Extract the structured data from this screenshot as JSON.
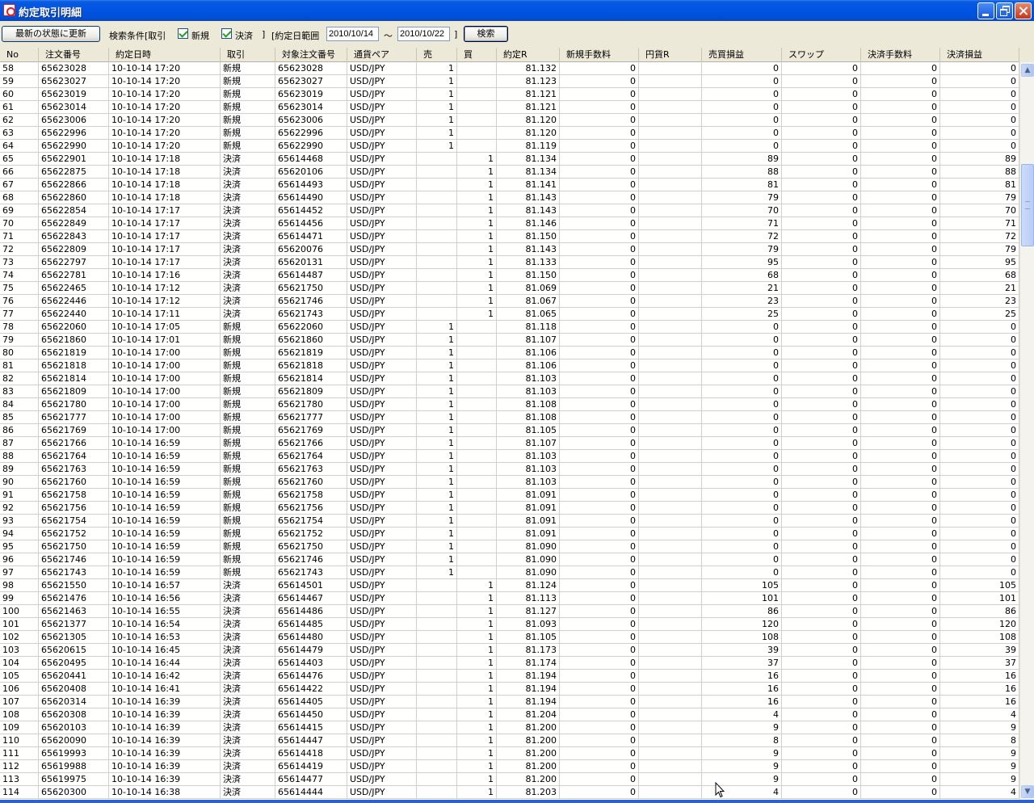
{
  "window": {
    "title": "約定取引明細",
    "icons": {
      "app": "app-logo-icon",
      "minimize": "minimize-icon",
      "maximize": "restore-icon",
      "close": "close-icon"
    }
  },
  "toolbar": {
    "refresh_label": "最新の状態に更新",
    "search_conditions_label": "検索条件[取引",
    "new_label": "新規",
    "settle_label": "決済",
    "bracket_close": "]",
    "date_range_label": "[約定日範囲",
    "date_from": "2010/10/14",
    "tilde": "〜",
    "date_to": "2010/10/22",
    "bracket_close2": "]",
    "search_label": "検索",
    "new_checked": true,
    "settle_checked": true
  },
  "grid": {
    "columns": [
      "No",
      "注文番号",
      "約定日時",
      "取引",
      "対象注文番号",
      "通貨ペア",
      "売",
      "買",
      "約定R",
      "新規手数料",
      "円貨R",
      "売買損益",
      "スワップ",
      "決済手数料",
      "決済損益"
    ],
    "rows": [
      [
        "58",
        "65623028",
        "10-10-14 17:20",
        "新規",
        "65623028",
        "USD/JPY",
        "1",
        "",
        "81.132",
        "0",
        "",
        "0",
        "0",
        "0",
        "0"
      ],
      [
        "59",
        "65623027",
        "10-10-14 17:20",
        "新規",
        "65623027",
        "USD/JPY",
        "1",
        "",
        "81.123",
        "0",
        "",
        "0",
        "0",
        "0",
        "0"
      ],
      [
        "60",
        "65623019",
        "10-10-14 17:20",
        "新規",
        "65623019",
        "USD/JPY",
        "1",
        "",
        "81.121",
        "0",
        "",
        "0",
        "0",
        "0",
        "0"
      ],
      [
        "61",
        "65623014",
        "10-10-14 17:20",
        "新規",
        "65623014",
        "USD/JPY",
        "1",
        "",
        "81.121",
        "0",
        "",
        "0",
        "0",
        "0",
        "0"
      ],
      [
        "62",
        "65623006",
        "10-10-14 17:20",
        "新規",
        "65623006",
        "USD/JPY",
        "1",
        "",
        "81.120",
        "0",
        "",
        "0",
        "0",
        "0",
        "0"
      ],
      [
        "63",
        "65622996",
        "10-10-14 17:20",
        "新規",
        "65622996",
        "USD/JPY",
        "1",
        "",
        "81.120",
        "0",
        "",
        "0",
        "0",
        "0",
        "0"
      ],
      [
        "64",
        "65622990",
        "10-10-14 17:20",
        "新規",
        "65622990",
        "USD/JPY",
        "1",
        "",
        "81.119",
        "0",
        "",
        "0",
        "0",
        "0",
        "0"
      ],
      [
        "65",
        "65622901",
        "10-10-14 17:18",
        "決済",
        "65614468",
        "USD/JPY",
        "",
        "1",
        "81.134",
        "0",
        "",
        "89",
        "0",
        "0",
        "89"
      ],
      [
        "66",
        "65622875",
        "10-10-14 17:18",
        "決済",
        "65620106",
        "USD/JPY",
        "",
        "1",
        "81.134",
        "0",
        "",
        "88",
        "0",
        "0",
        "88"
      ],
      [
        "67",
        "65622866",
        "10-10-14 17:18",
        "決済",
        "65614493",
        "USD/JPY",
        "",
        "1",
        "81.141",
        "0",
        "",
        "81",
        "0",
        "0",
        "81"
      ],
      [
        "68",
        "65622860",
        "10-10-14 17:18",
        "決済",
        "65614490",
        "USD/JPY",
        "",
        "1",
        "81.143",
        "0",
        "",
        "79",
        "0",
        "0",
        "79"
      ],
      [
        "69",
        "65622854",
        "10-10-14 17:17",
        "決済",
        "65614452",
        "USD/JPY",
        "",
        "1",
        "81.143",
        "0",
        "",
        "70",
        "0",
        "0",
        "70"
      ],
      [
        "70",
        "65622849",
        "10-10-14 17:17",
        "決済",
        "65614456",
        "USD/JPY",
        "",
        "1",
        "81.146",
        "0",
        "",
        "71",
        "0",
        "0",
        "71"
      ],
      [
        "71",
        "65622843",
        "10-10-14 17:17",
        "決済",
        "65614471",
        "USD/JPY",
        "",
        "1",
        "81.150",
        "0",
        "",
        "72",
        "0",
        "0",
        "72"
      ],
      [
        "72",
        "65622809",
        "10-10-14 17:17",
        "決済",
        "65620076",
        "USD/JPY",
        "",
        "1",
        "81.143",
        "0",
        "",
        "79",
        "0",
        "0",
        "79"
      ],
      [
        "73",
        "65622797",
        "10-10-14 17:17",
        "決済",
        "65620131",
        "USD/JPY",
        "",
        "1",
        "81.133",
        "0",
        "",
        "95",
        "0",
        "0",
        "95"
      ],
      [
        "74",
        "65622781",
        "10-10-14 17:16",
        "決済",
        "65614487",
        "USD/JPY",
        "",
        "1",
        "81.150",
        "0",
        "",
        "68",
        "0",
        "0",
        "68"
      ],
      [
        "75",
        "65622465",
        "10-10-14 17:12",
        "決済",
        "65621750",
        "USD/JPY",
        "",
        "1",
        "81.069",
        "0",
        "",
        "21",
        "0",
        "0",
        "21"
      ],
      [
        "76",
        "65622446",
        "10-10-14 17:12",
        "決済",
        "65621746",
        "USD/JPY",
        "",
        "1",
        "81.067",
        "0",
        "",
        "23",
        "0",
        "0",
        "23"
      ],
      [
        "77",
        "65622440",
        "10-10-14 17:11",
        "決済",
        "65621743",
        "USD/JPY",
        "",
        "1",
        "81.065",
        "0",
        "",
        "25",
        "0",
        "0",
        "25"
      ],
      [
        "78",
        "65622060",
        "10-10-14 17:05",
        "新規",
        "65622060",
        "USD/JPY",
        "1",
        "",
        "81.118",
        "0",
        "",
        "0",
        "0",
        "0",
        "0"
      ],
      [
        "79",
        "65621860",
        "10-10-14 17:01",
        "新規",
        "65621860",
        "USD/JPY",
        "1",
        "",
        "81.107",
        "0",
        "",
        "0",
        "0",
        "0",
        "0"
      ],
      [
        "80",
        "65621819",
        "10-10-14 17:00",
        "新規",
        "65621819",
        "USD/JPY",
        "1",
        "",
        "81.106",
        "0",
        "",
        "0",
        "0",
        "0",
        "0"
      ],
      [
        "81",
        "65621818",
        "10-10-14 17:00",
        "新規",
        "65621818",
        "USD/JPY",
        "1",
        "",
        "81.106",
        "0",
        "",
        "0",
        "0",
        "0",
        "0"
      ],
      [
        "82",
        "65621814",
        "10-10-14 17:00",
        "新規",
        "65621814",
        "USD/JPY",
        "1",
        "",
        "81.103",
        "0",
        "",
        "0",
        "0",
        "0",
        "0"
      ],
      [
        "83",
        "65621809",
        "10-10-14 17:00",
        "新規",
        "65621809",
        "USD/JPY",
        "1",
        "",
        "81.103",
        "0",
        "",
        "0",
        "0",
        "0",
        "0"
      ],
      [
        "84",
        "65621780",
        "10-10-14 17:00",
        "新規",
        "65621780",
        "USD/JPY",
        "1",
        "",
        "81.108",
        "0",
        "",
        "0",
        "0",
        "0",
        "0"
      ],
      [
        "85",
        "65621777",
        "10-10-14 17:00",
        "新規",
        "65621777",
        "USD/JPY",
        "1",
        "",
        "81.108",
        "0",
        "",
        "0",
        "0",
        "0",
        "0"
      ],
      [
        "86",
        "65621769",
        "10-10-14 17:00",
        "新規",
        "65621769",
        "USD/JPY",
        "1",
        "",
        "81.105",
        "0",
        "",
        "0",
        "0",
        "0",
        "0"
      ],
      [
        "87",
        "65621766",
        "10-10-14 16:59",
        "新規",
        "65621766",
        "USD/JPY",
        "1",
        "",
        "81.107",
        "0",
        "",
        "0",
        "0",
        "0",
        "0"
      ],
      [
        "88",
        "65621764",
        "10-10-14 16:59",
        "新規",
        "65621764",
        "USD/JPY",
        "1",
        "",
        "81.103",
        "0",
        "",
        "0",
        "0",
        "0",
        "0"
      ],
      [
        "89",
        "65621763",
        "10-10-14 16:59",
        "新規",
        "65621763",
        "USD/JPY",
        "1",
        "",
        "81.103",
        "0",
        "",
        "0",
        "0",
        "0",
        "0"
      ],
      [
        "90",
        "65621760",
        "10-10-14 16:59",
        "新規",
        "65621760",
        "USD/JPY",
        "1",
        "",
        "81.103",
        "0",
        "",
        "0",
        "0",
        "0",
        "0"
      ],
      [
        "91",
        "65621758",
        "10-10-14 16:59",
        "新規",
        "65621758",
        "USD/JPY",
        "1",
        "",
        "81.091",
        "0",
        "",
        "0",
        "0",
        "0",
        "0"
      ],
      [
        "92",
        "65621756",
        "10-10-14 16:59",
        "新規",
        "65621756",
        "USD/JPY",
        "1",
        "",
        "81.091",
        "0",
        "",
        "0",
        "0",
        "0",
        "0"
      ],
      [
        "93",
        "65621754",
        "10-10-14 16:59",
        "新規",
        "65621754",
        "USD/JPY",
        "1",
        "",
        "81.091",
        "0",
        "",
        "0",
        "0",
        "0",
        "0"
      ],
      [
        "94",
        "65621752",
        "10-10-14 16:59",
        "新規",
        "65621752",
        "USD/JPY",
        "1",
        "",
        "81.091",
        "0",
        "",
        "0",
        "0",
        "0",
        "0"
      ],
      [
        "95",
        "65621750",
        "10-10-14 16:59",
        "新規",
        "65621750",
        "USD/JPY",
        "1",
        "",
        "81.090",
        "0",
        "",
        "0",
        "0",
        "0",
        "0"
      ],
      [
        "96",
        "65621746",
        "10-10-14 16:59",
        "新規",
        "65621746",
        "USD/JPY",
        "1",
        "",
        "81.090",
        "0",
        "",
        "0",
        "0",
        "0",
        "0"
      ],
      [
        "97",
        "65621743",
        "10-10-14 16:59",
        "新規",
        "65621743",
        "USD/JPY",
        "1",
        "",
        "81.090",
        "0",
        "",
        "0",
        "0",
        "0",
        "0"
      ],
      [
        "98",
        "65621550",
        "10-10-14 16:57",
        "決済",
        "65614501",
        "USD/JPY",
        "",
        "1",
        "81.124",
        "0",
        "",
        "105",
        "0",
        "0",
        "105"
      ],
      [
        "99",
        "65621476",
        "10-10-14 16:56",
        "決済",
        "65614467",
        "USD/JPY",
        "",
        "1",
        "81.113",
        "0",
        "",
        "101",
        "0",
        "0",
        "101"
      ],
      [
        "100",
        "65621463",
        "10-10-14 16:55",
        "決済",
        "65614486",
        "USD/JPY",
        "",
        "1",
        "81.127",
        "0",
        "",
        "86",
        "0",
        "0",
        "86"
      ],
      [
        "101",
        "65621377",
        "10-10-14 16:54",
        "決済",
        "65614485",
        "USD/JPY",
        "",
        "1",
        "81.093",
        "0",
        "",
        "120",
        "0",
        "0",
        "120"
      ],
      [
        "102",
        "65621305",
        "10-10-14 16:53",
        "決済",
        "65614480",
        "USD/JPY",
        "",
        "1",
        "81.105",
        "0",
        "",
        "108",
        "0",
        "0",
        "108"
      ],
      [
        "103",
        "65620615",
        "10-10-14 16:45",
        "決済",
        "65614479",
        "USD/JPY",
        "",
        "1",
        "81.173",
        "0",
        "",
        "39",
        "0",
        "0",
        "39"
      ],
      [
        "104",
        "65620495",
        "10-10-14 16:44",
        "決済",
        "65614403",
        "USD/JPY",
        "",
        "1",
        "81.174",
        "0",
        "",
        "37",
        "0",
        "0",
        "37"
      ],
      [
        "105",
        "65620441",
        "10-10-14 16:42",
        "決済",
        "65614476",
        "USD/JPY",
        "",
        "1",
        "81.194",
        "0",
        "",
        "16",
        "0",
        "0",
        "16"
      ],
      [
        "106",
        "65620408",
        "10-10-14 16:41",
        "決済",
        "65614422",
        "USD/JPY",
        "",
        "1",
        "81.194",
        "0",
        "",
        "16",
        "0",
        "0",
        "16"
      ],
      [
        "107",
        "65620314",
        "10-10-14 16:39",
        "決済",
        "65614405",
        "USD/JPY",
        "",
        "1",
        "81.194",
        "0",
        "",
        "16",
        "0",
        "0",
        "16"
      ],
      [
        "108",
        "65620308",
        "10-10-14 16:39",
        "決済",
        "65614450",
        "USD/JPY",
        "",
        "1",
        "81.204",
        "0",
        "",
        "4",
        "0",
        "0",
        "4"
      ],
      [
        "109",
        "65620103",
        "10-10-14 16:39",
        "決済",
        "65614415",
        "USD/JPY",
        "",
        "1",
        "81.200",
        "0",
        "",
        "9",
        "0",
        "0",
        "9"
      ],
      [
        "110",
        "65620090",
        "10-10-14 16:39",
        "決済",
        "65614447",
        "USD/JPY",
        "",
        "1",
        "81.200",
        "0",
        "",
        "8",
        "0",
        "0",
        "8"
      ],
      [
        "111",
        "65619993",
        "10-10-14 16:39",
        "決済",
        "65614418",
        "USD/JPY",
        "",
        "1",
        "81.200",
        "0",
        "",
        "9",
        "0",
        "0",
        "9"
      ],
      [
        "112",
        "65619988",
        "10-10-14 16:39",
        "決済",
        "65614419",
        "USD/JPY",
        "",
        "1",
        "81.200",
        "0",
        "",
        "9",
        "0",
        "0",
        "9"
      ],
      [
        "113",
        "65619975",
        "10-10-14 16:39",
        "決済",
        "65614477",
        "USD/JPY",
        "",
        "1",
        "81.200",
        "0",
        "",
        "9",
        "0",
        "0",
        "9"
      ],
      [
        "114",
        "65620300",
        "10-10-14 16:38",
        "決済",
        "65614444",
        "USD/JPY",
        "",
        "1",
        "81.203",
        "0",
        "",
        "4",
        "0",
        "0",
        "4"
      ]
    ]
  },
  "colors": {
    "titlebar": "#0055e5",
    "window_bg": "#ece9d8",
    "grid_line": "#d4d0c8",
    "checkmark": "#21a121"
  }
}
